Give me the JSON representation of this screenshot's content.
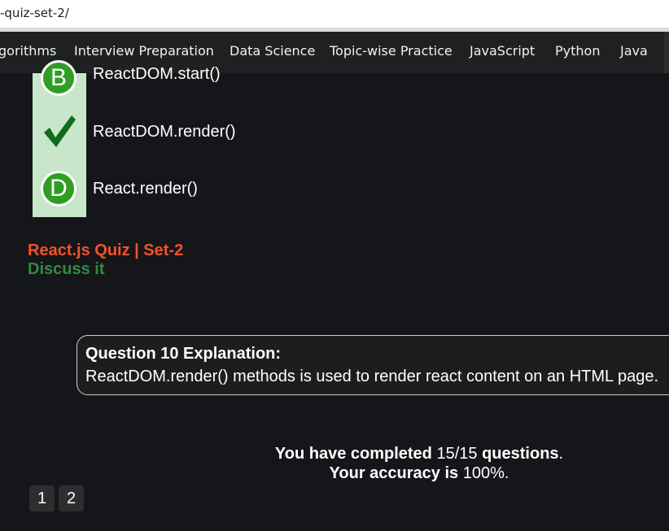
{
  "browser": {
    "url_fragment": "-quiz-set-2/"
  },
  "nav": {
    "items": [
      "gorithms",
      "Interview Preparation",
      "Data Science",
      "Topic-wise Practice",
      "JavaScript",
      "Python",
      "Java"
    ]
  },
  "options": [
    {
      "marker": "B",
      "text": "ReactDOM.start()"
    },
    {
      "marker": "check-icon",
      "text": "ReactDOM.render()"
    },
    {
      "marker": "D",
      "text": "React.render()"
    }
  ],
  "quiz": {
    "title": "React.js Quiz | Set-2",
    "discuss": "Discuss it"
  },
  "explanation": {
    "heading": "Question 10 Explanation:",
    "body": "ReactDOM.render() methods is used to render react content on an HTML page."
  },
  "summary": {
    "completed_prefix": "You have completed",
    "completed_value": "15/15",
    "completed_suffix": "questions",
    "accuracy_prefix": "Your accuracy is",
    "accuracy_value": "100%"
  },
  "pagination": [
    "1",
    "2"
  ],
  "colors": {
    "accent_green": "#2f9e23",
    "title_red": "#f0532b",
    "discuss_green": "#2f8c3f",
    "option_bg": "#c8e6c9"
  }
}
